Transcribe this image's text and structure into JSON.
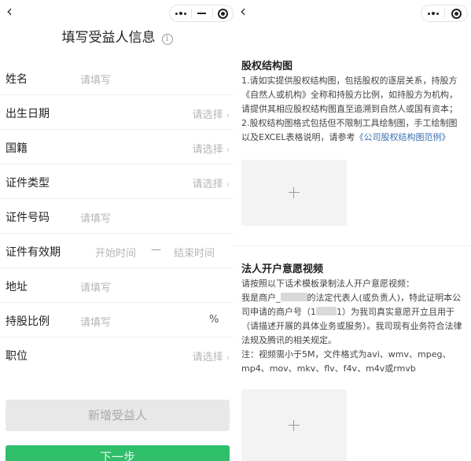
{
  "left_screen": {
    "title": "填写受益人信息",
    "info_glyph": "i",
    "fields": [
      {
        "label": "姓名",
        "placeholder": "请填写",
        "kind": "text"
      },
      {
        "label": "出生日期",
        "placeholder": "请选择",
        "kind": "select"
      },
      {
        "label": "国籍",
        "placeholder": "请选择",
        "kind": "select"
      },
      {
        "label": "证件类型",
        "placeholder": "请选择",
        "kind": "select"
      },
      {
        "label": "证件号码",
        "placeholder": "请填写",
        "kind": "text"
      },
      {
        "label": "证件有效期",
        "start_placeholder": "开始时间",
        "range_separator": "—",
        "end_placeholder": "结束时间",
        "kind": "daterange"
      },
      {
        "label": "地址",
        "placeholder": "请填写",
        "kind": "text"
      },
      {
        "label": "持股比例",
        "placeholder": "请填写",
        "unit": "%",
        "kind": "percent"
      },
      {
        "label": "职位",
        "placeholder": "请选择",
        "kind": "select"
      }
    ],
    "add_button": "新增受益人",
    "next_button": "下一步"
  },
  "right_screen": {
    "equity": {
      "title": "股权结构图",
      "line1": "1.请如实提供股权结构图，包括股权的逐层关系，持股方《自然人或机构》全称和持股方比例，如持股方为机构，请提供其相应股权结构图直至追溯到自然人或国有资本；",
      "line2_prefix": "2.股权结构图格式包括但不限制工具绘制图，手工绘制图以及EXCEL表格说明，请参考",
      "line2_link": "《公司股权结构图范例》"
    },
    "video": {
      "title": "法人开户意愿视频",
      "intro": "请按照以下话术模板录制法人开户意愿视频：",
      "script_a": "我是商户_",
      "script_b": "的法定代表人(或负责人)，特此证明本公司申请的商户号（1",
      "script_c": "1）为我司真实意愿开立且用于（请描述开展的具体业务或服务）。我司现有业务符合法律法规及腾讯的相关规定。",
      "note": "注：视频需小于5M，文件格式为avi、wmv、mpeg、mp4、mov、mkv、flv、f4v、m4v或rmvb"
    }
  },
  "icons": {
    "back": "chevron-left-icon",
    "more": "more-dots-icon",
    "minimize": "minimize-icon",
    "close": "target-close-icon",
    "upload": "plus-icon",
    "chevron": "chevron-right-icon"
  },
  "colors": {
    "primary": "#2fbe6a",
    "link": "#3a6fb0",
    "placeholder": "#b5b5b5",
    "disabled_button": "#e8e8e8"
  }
}
